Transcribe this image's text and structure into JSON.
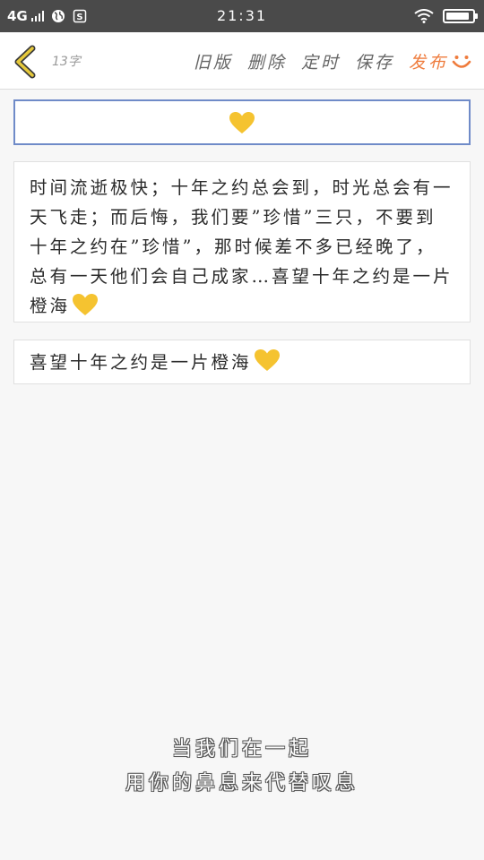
{
  "status_bar": {
    "network": "4G",
    "time": "21:31",
    "battery_level": 0.9
  },
  "toolbar": {
    "word_count": "13字",
    "actions": [
      {
        "label": "旧版",
        "color": "#666666"
      },
      {
        "label": "删除",
        "color": "#666666"
      },
      {
        "label": "定时",
        "color": "#666666"
      },
      {
        "label": "保存",
        "color": "#666666"
      },
      {
        "label": "发布",
        "color": "#ef7c3d"
      }
    ],
    "accent_color": "#ef7c3d"
  },
  "title_field": {
    "value_icon": "yellow-heart-icon",
    "border_color": "#6f8bc8"
  },
  "content": {
    "body_text": "时间流逝极快；十年之约总会到，时光总会有一天飞走；而后悔，我们要”珍惜”三只，不要到十年之约在”珍惜”，那时候差不多已经晚了，总有一天他们会自己成家…喜望十年之约是一片橙海",
    "quote_text": "喜望十年之约是一片橙海"
  },
  "overlay": {
    "line1": "当我们在一起",
    "line2": "用你的鼻息来代替叹息"
  },
  "colors": {
    "heart": "#f5c330",
    "status_bar_bg": "#4a4a4a",
    "back_icon": "#e6c93b"
  }
}
